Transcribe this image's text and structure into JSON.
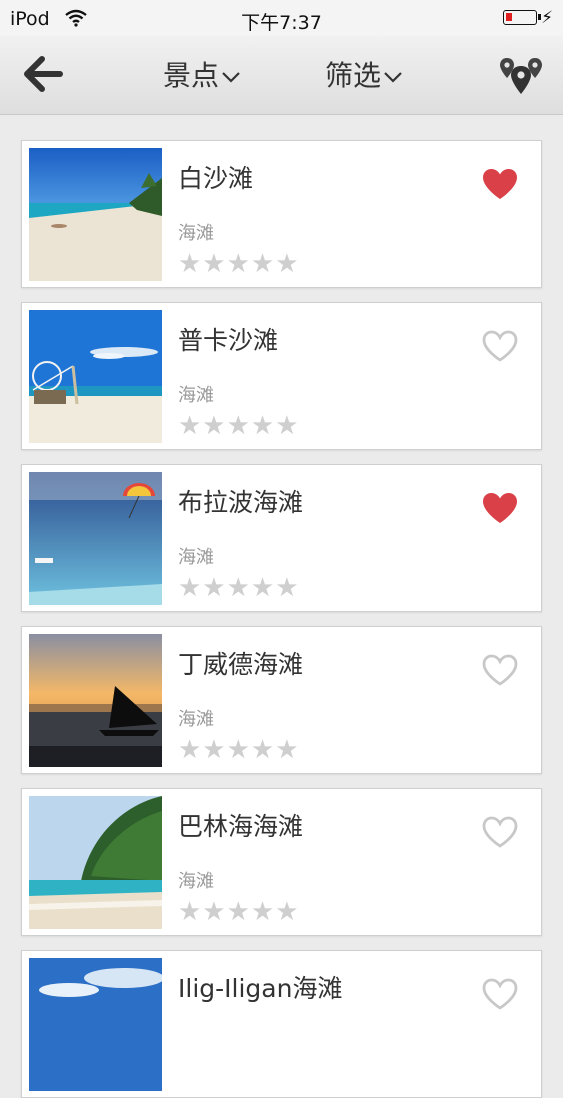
{
  "status_bar": {
    "carrier": "iPod",
    "time": "下午7:37",
    "charging_symbol": "⚡"
  },
  "nav": {
    "back_icon": "back-arrow-icon",
    "tab_sights": "景点",
    "tab_filter": "筛选",
    "map_icon": "map-pins-icon"
  },
  "colors": {
    "favorite_active": "#d94047",
    "favorite_inactive": "#c8c8c8",
    "star_inactive": "#cfcfcf"
  },
  "items": [
    {
      "title": "白沙滩",
      "category": "海滩",
      "stars": "★★★★★",
      "rating": 0,
      "favorited": true
    },
    {
      "title": "普卡沙滩",
      "category": "海滩",
      "stars": "★★★★★",
      "rating": 0,
      "favorited": false
    },
    {
      "title": "布拉波海滩",
      "category": "海滩",
      "stars": "★★★★★",
      "rating": 0,
      "favorited": true
    },
    {
      "title": "丁威德海滩",
      "category": "海滩",
      "stars": "★★★★★",
      "rating": 0,
      "favorited": false
    },
    {
      "title": "巴林海海滩",
      "category": "海滩",
      "stars": "★★★★★",
      "rating": 0,
      "favorited": false
    },
    {
      "title": "Ilig-Iligan海滩",
      "category": "",
      "stars": "",
      "rating": 0,
      "favorited": false
    }
  ]
}
